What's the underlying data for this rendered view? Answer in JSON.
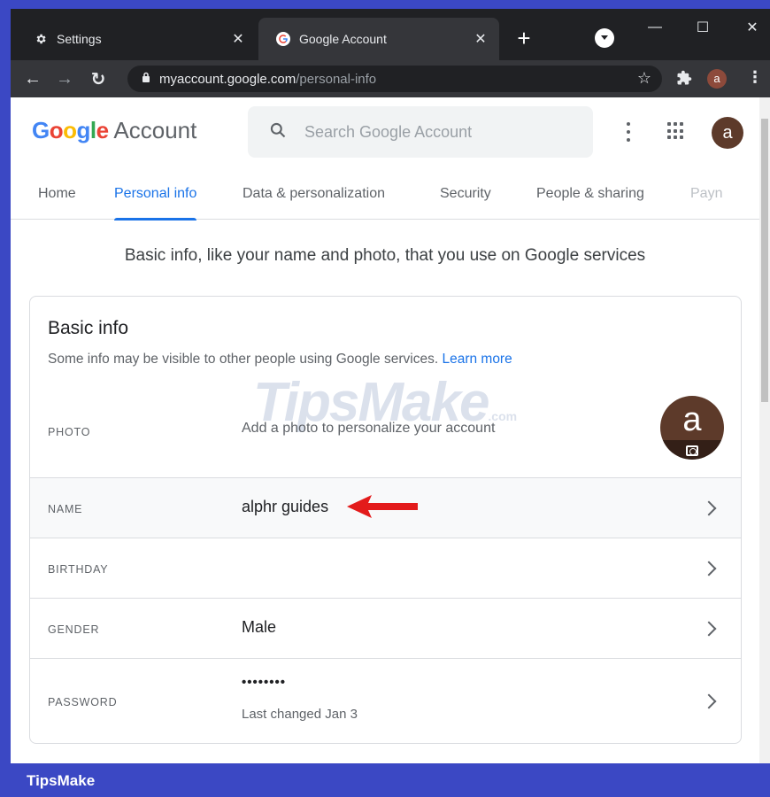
{
  "browser": {
    "tabs": [
      {
        "title": "Settings",
        "active": false,
        "icon": "gear-icon"
      },
      {
        "title": "Google Account",
        "active": true,
        "icon": "google-g-icon"
      }
    ],
    "url_host": "myaccount.google.com",
    "url_path": "/personal-info",
    "profile_initial": "a"
  },
  "header": {
    "logo_word": "Google",
    "logo_suffix": " Account",
    "search_placeholder": "Search Google Account",
    "avatar_initial": "a"
  },
  "nav": {
    "tabs": [
      "Home",
      "Personal info",
      "Data & personalization",
      "Security",
      "People & sharing",
      "Payn"
    ],
    "selected": "Personal info"
  },
  "intro": "Basic info, like your name and photo, that you use on Google services",
  "basic_info": {
    "title": "Basic info",
    "subtitle": "Some info may be visible to other people using Google services.",
    "learn_more": "Learn more",
    "rows": [
      {
        "label": "PHOTO",
        "value": "Add a photo to personalize your account",
        "initial": "a"
      },
      {
        "label": "NAME",
        "value": "alphr guides"
      },
      {
        "label": "BIRTHDAY",
        "value": ""
      },
      {
        "label": "GENDER",
        "value": "Male"
      },
      {
        "label": "PASSWORD",
        "value": "••••••••",
        "note": "Last changed Jan 3"
      }
    ]
  },
  "watermark": {
    "text": "TipsMake",
    "suffix": ".com"
  },
  "footer": {
    "brand": "TipsMake"
  },
  "colors": {
    "accent": "#1a73e8",
    "arrow": "#e31b1b",
    "frame": "#3b48c4"
  }
}
